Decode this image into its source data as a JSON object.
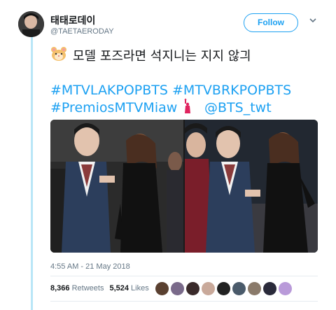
{
  "user": {
    "display_name": "태태로데이",
    "handle": "@TAETAERODAY"
  },
  "follow_button": {
    "label": "Follow"
  },
  "tweet": {
    "emoji": "hamster-face-emoji",
    "text_line1": "모델 포즈라면 석지니는 지지 않긔",
    "hashtag1": "#MTVLAKPOPBTS",
    "hashtag2": "#MTVBRKPOPBTS",
    "hashtag3": "#PremiosMTVMiaw",
    "inline_emoji": "statue-of-liberty-emoji",
    "mention": "@BTS_twt"
  },
  "timestamp": "4:55 AM - 21 May 2018",
  "stats": {
    "retweets_count": "8,366",
    "retweets_label": "Retweets",
    "likes_count": "5,524",
    "likes_label": "Likes"
  },
  "likers": [
    "avatar-1",
    "avatar-2",
    "avatar-3",
    "avatar-4",
    "avatar-5",
    "avatar-6",
    "avatar-7",
    "avatar-8",
    "avatar-9"
  ],
  "colors": {
    "accent": "#1da1f2",
    "text": "#14171a",
    "muted": "#657786",
    "thread_line": "#b9e6f7"
  }
}
